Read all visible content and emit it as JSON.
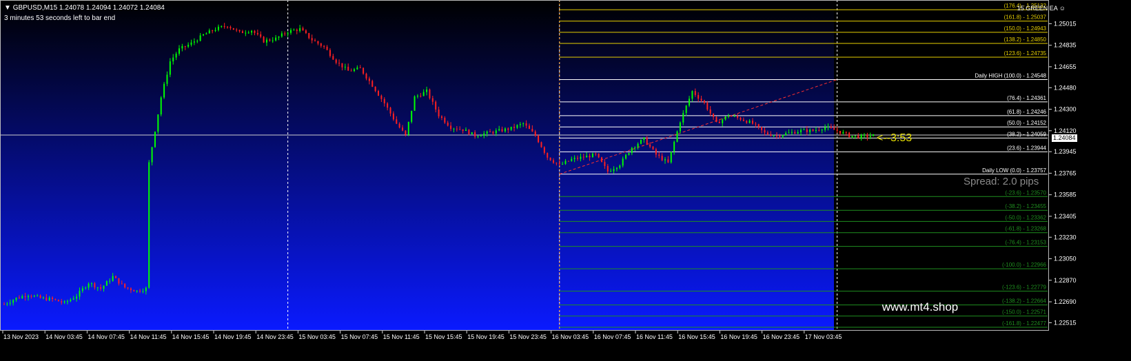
{
  "header": {
    "symbol_line": "GBPUSD,M15  1.24078 1.24094 1.24072 1.24084",
    "timer": "3 minutes 53 seconds left to bar end"
  },
  "ea_label": "15 GREEN EA",
  "watermark": "www.mt4.shop",
  "countdown": "<--3:53",
  "spread": "Spread: 2.0 pips",
  "current_price": "1.24084",
  "colors": {
    "bg_top": "#000000",
    "bg_bottom": "#0a1aff",
    "bull": "#00ff00",
    "bear": "#ff2020",
    "fib_upper": "#e8d000",
    "fib_main": "#ffffff",
    "fib_lower": "#1f8f1f",
    "trend": "#ff3030",
    "vline": "#ffffff",
    "orange_vline": "#ff8c00"
  },
  "chart_data": {
    "type": "candlestick",
    "symbol": "GBPUSD",
    "timeframe": "M15",
    "y_axis_ticks": [
      "1.25015",
      "1.24835",
      "1.24655",
      "1.24480",
      "1.24300",
      "1.24120",
      "1.23945",
      "1.23765",
      "1.23585",
      "1.23405",
      "1.23230",
      "1.23050",
      "1.22870",
      "1.22690",
      "1.22515"
    ],
    "ylim": [
      1.2246,
      1.2519
    ],
    "x_axis_ticks": [
      "13 Nov 2023",
      "14 Nov 03:45",
      "14 Nov 07:45",
      "14 Nov 11:45",
      "14 Nov 15:45",
      "14 Nov 19:45",
      "14 Nov 23:45",
      "15 Nov 03:45",
      "15 Nov 07:45",
      "15 Nov 11:45",
      "15 Nov 15:45",
      "15 Nov 19:45",
      "15 Nov 23:45",
      "16 Nov 03:45",
      "16 Nov 07:45",
      "16 Nov 11:45",
      "16 Nov 15:45",
      "16 Nov 19:45",
      "16 Nov 23:45",
      "17 Nov 03:45"
    ],
    "close_path": [
      [
        0,
        1.2267
      ],
      [
        4,
        1.2272
      ],
      [
        8,
        1.2275
      ],
      [
        12,
        1.2272
      ],
      [
        16,
        1.2271
      ],
      [
        20,
        1.2268
      ],
      [
        24,
        1.2274
      ],
      [
        28,
        1.2285
      ],
      [
        32,
        1.228
      ],
      [
        36,
        1.229
      ],
      [
        40,
        1.2281
      ],
      [
        44,
        1.2278
      ],
      [
        47,
        1.228
      ],
      [
        48,
        1.2385
      ],
      [
        52,
        1.244
      ],
      [
        55,
        1.247
      ],
      [
        58,
        1.248
      ],
      [
        62,
        1.2485
      ],
      [
        66,
        1.2492
      ],
      [
        70,
        1.2497
      ],
      [
        74,
        1.25
      ],
      [
        78,
        1.2494
      ],
      [
        82,
        1.2496
      ],
      [
        86,
        1.2487
      ],
      [
        90,
        1.2489
      ],
      [
        94,
        1.2495
      ],
      [
        98,
        1.2497
      ],
      [
        102,
        1.2488
      ],
      [
        106,
        1.2482
      ],
      [
        110,
        1.247
      ],
      [
        114,
        1.2462
      ],
      [
        118,
        1.2464
      ],
      [
        122,
        1.245
      ],
      [
        126,
        1.2435
      ],
      [
        130,
        1.2418
      ],
      [
        133,
        1.2408
      ],
      [
        136,
        1.244
      ],
      [
        140,
        1.2445
      ],
      [
        144,
        1.2425
      ],
      [
        148,
        1.2415
      ],
      [
        152,
        1.2413
      ],
      [
        156,
        1.2408
      ],
      [
        160,
        1.241
      ],
      [
        164,
        1.2412
      ],
      [
        168,
        1.2414
      ],
      [
        172,
        1.2418
      ],
      [
        176,
        1.2408
      ],
      [
        180,
        1.239
      ],
      [
        184,
        1.2383
      ],
      [
        188,
        1.2388
      ],
      [
        192,
        1.239
      ],
      [
        196,
        1.2392
      ],
      [
        200,
        1.2378
      ],
      [
        204,
        1.2384
      ],
      [
        208,
        1.2398
      ],
      [
        212,
        1.2405
      ],
      [
        216,
        1.2392
      ],
      [
        220,
        1.2385
      ],
      [
        224,
        1.242
      ],
      [
        228,
        1.2445
      ],
      [
        232,
        1.2435
      ],
      [
        236,
        1.2418
      ],
      [
        240,
        1.2425
      ],
      [
        244,
        1.2422
      ],
      [
        248,
        1.2418
      ],
      [
        252,
        1.241
      ],
      [
        256,
        1.2408
      ],
      [
        260,
        1.241
      ],
      [
        264,
        1.2412
      ],
      [
        268,
        1.2412
      ],
      [
        272,
        1.2415
      ],
      [
        276,
        1.2412
      ],
      [
        280,
        1.2408
      ],
      [
        284,
        1.2407
      ],
      [
        288,
        1.2408
      ]
    ],
    "fibonacci_levels": [
      {
        "label": "(176.4) - 1.25132",
        "price": 1.25132,
        "zone": "upper"
      },
      {
        "label": "(161.8) - 1.25037",
        "price": 1.25037,
        "zone": "upper"
      },
      {
        "label": "(150.0) - 1.24943",
        "price": 1.24943,
        "zone": "upper"
      },
      {
        "label": "(138.2) - 1.24850",
        "price": 1.2485,
        "zone": "upper"
      },
      {
        "label": "(123.6) - 1.24735",
        "price": 1.24735,
        "zone": "upper"
      },
      {
        "label": "Daily HIGH (100.0) - 1.24548",
        "price": 1.24548,
        "zone": "main"
      },
      {
        "label": "(76.4) - 1.24361",
        "price": 1.24361,
        "zone": "main"
      },
      {
        "label": "(61.8) - 1.24246",
        "price": 1.24246,
        "zone": "main"
      },
      {
        "label": "(50.0) - 1.24152",
        "price": 1.24152,
        "zone": "main"
      },
      {
        "label": "(38.2) - 1.24059",
        "price": 1.24059,
        "zone": "main"
      },
      {
        "label": "(23.6) - 1.23944",
        "price": 1.23944,
        "zone": "main"
      },
      {
        "label": "Daily LOW (0.0) - 1.23757",
        "price": 1.23757,
        "zone": "main"
      },
      {
        "label": "(-23.6) - 1.23570",
        "price": 1.2357,
        "zone": "lower"
      },
      {
        "label": "(-38.2) - 1.23455",
        "price": 1.23455,
        "zone": "lower"
      },
      {
        "label": "(-50.0) - 1.23362",
        "price": 1.23362,
        "zone": "lower"
      },
      {
        "label": "(-61.8) - 1.23268",
        "price": 1.23268,
        "zone": "lower"
      },
      {
        "label": "(-76.4) - 1.23153",
        "price": 1.23153,
        "zone": "lower"
      },
      {
        "label": "(-100.0) - 1.22966",
        "price": 1.22966,
        "zone": "lower"
      },
      {
        "label": "(-123.6) - 1.22779",
        "price": 1.22779,
        "zone": "lower"
      },
      {
        "label": "(-138.2) - 1.22664",
        "price": 1.22664,
        "zone": "lower"
      },
      {
        "label": "(-150.0) - 1.22571",
        "price": 1.22571,
        "zone": "lower"
      },
      {
        "label": "(-161.8) - 1.22477",
        "price": 1.22477,
        "zone": "lower"
      }
    ],
    "trendline": {
      "from": [
        184,
        1.23757
      ],
      "to": [
        276,
        1.24548
      ]
    },
    "vertical_separators": [
      94,
      184,
      276
    ],
    "fib_start_index": 184
  }
}
